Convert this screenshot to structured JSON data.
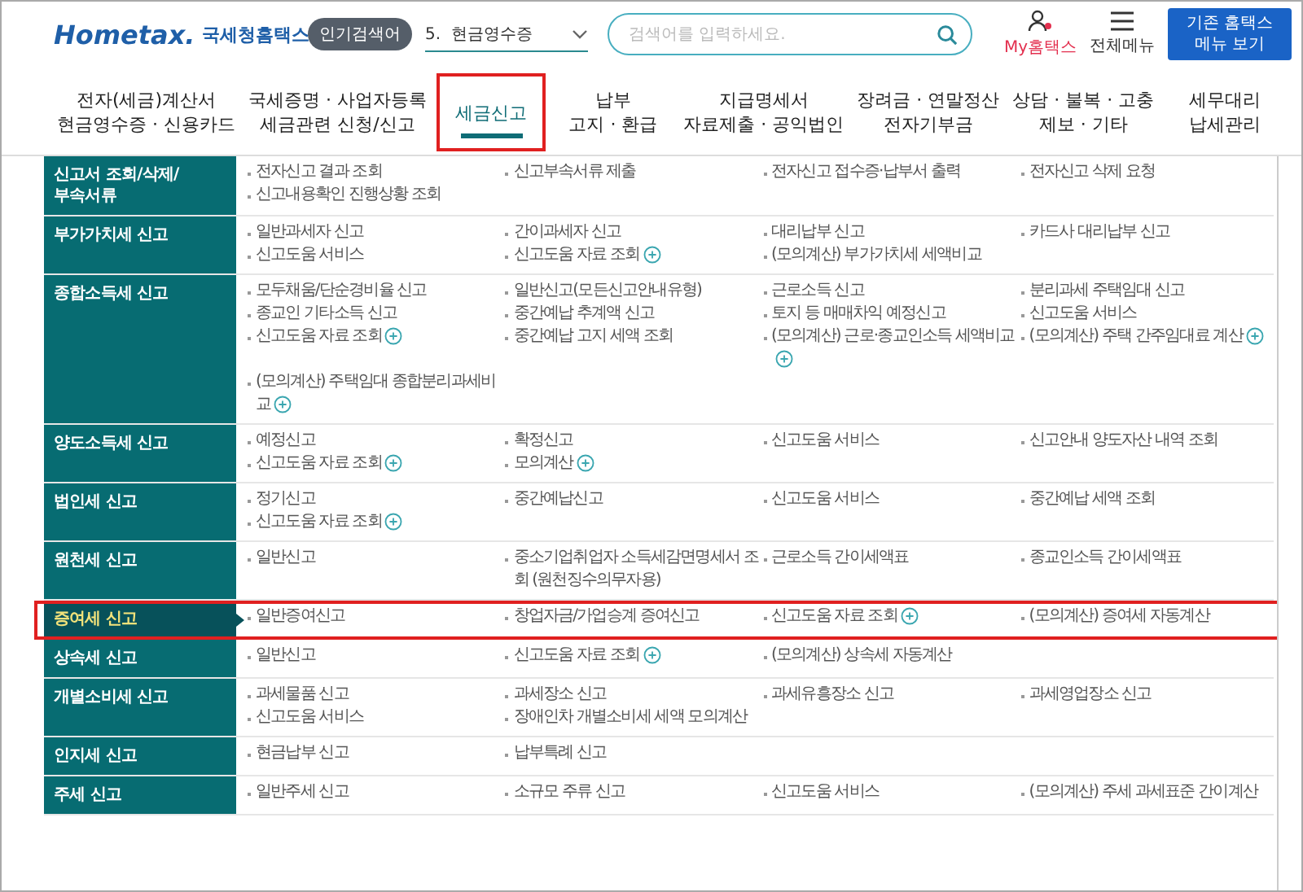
{
  "header": {
    "logo": {
      "brand": "Hometax.",
      "name": "국세청홈택스"
    },
    "popular_badge": "인기검색어",
    "popular_select": "5.  현금영수증",
    "search": {
      "placeholder": "검색어를 입력하세요."
    },
    "my_link": "My홈택스",
    "all_menu": "전체메뉴",
    "legacy_button": [
      "기존 홈택스",
      "메뉴 보기"
    ]
  },
  "nav": [
    {
      "lines": [
        "전자(세금)계산서",
        "현금영수증 · 신용카드"
      ],
      "selected": false,
      "highlighted": false
    },
    {
      "lines": [
        "국세증명 · 사업자등록",
        "세금관련 신청/신고"
      ],
      "selected": false,
      "highlighted": false
    },
    {
      "lines": [
        "세금신고"
      ],
      "selected": true,
      "highlighted": true
    },
    {
      "lines": [
        "납부",
        "고지 · 환급"
      ],
      "selected": false,
      "highlighted": false
    },
    {
      "lines": [
        "지급명세서",
        "자료제출 · 공익법인"
      ],
      "selected": false,
      "highlighted": false
    },
    {
      "lines": [
        "장려금 · 연말정산",
        "전자기부금"
      ],
      "selected": false,
      "highlighted": false
    },
    {
      "lines": [
        "상담 · 불복 · 고충",
        "제보 · 기타"
      ],
      "selected": false,
      "highlighted": false
    },
    {
      "lines": [
        "세무대리",
        "납세관리"
      ],
      "selected": false,
      "highlighted": false
    }
  ],
  "sections": [
    {
      "title": "신고서 조회/삭제/\n부속서류",
      "selected": false,
      "highlighted": false,
      "items": [
        {
          "label": "전자신고 결과 조회",
          "plus": false
        },
        {
          "label": "신고부속서류 제출",
          "plus": false
        },
        {
          "label": "전자신고 접수증·납부서 출력",
          "plus": false
        },
        {
          "label": "전자신고 삭제 요청",
          "plus": false
        },
        {
          "label": "신고내용확인 진행상황 조회",
          "plus": false
        }
      ]
    },
    {
      "title": "부가가치세 신고",
      "selected": false,
      "highlighted": false,
      "items": [
        {
          "label": "일반과세자 신고",
          "plus": false
        },
        {
          "label": "간이과세자 신고",
          "plus": false
        },
        {
          "label": "대리납부 신고",
          "plus": false
        },
        {
          "label": "카드사 대리납부 신고",
          "plus": false
        },
        {
          "label": "신고도움 서비스",
          "plus": false
        },
        {
          "label": "신고도움 자료 조회",
          "plus": true
        },
        {
          "label": "(모의계산) 부가가치세 세액비교",
          "plus": false
        }
      ]
    },
    {
      "title": "종합소득세 신고",
      "selected": false,
      "highlighted": false,
      "items": [
        {
          "label": "모두채움/단순경비율 신고",
          "plus": false
        },
        {
          "label": "일반신고(모든신고안내유형)",
          "plus": false
        },
        {
          "label": "근로소득 신고",
          "plus": false
        },
        {
          "label": "분리과세 주택임대 신고",
          "plus": false
        },
        {
          "label": "종교인 기타소득 신고",
          "plus": false
        },
        {
          "label": "중간예납 추계액 신고",
          "plus": false
        },
        {
          "label": "토지 등 매매차익 예정신고",
          "plus": false
        },
        {
          "label": "신고도움 서비스",
          "plus": false
        },
        {
          "label": "신고도움 자료 조회",
          "plus": true
        },
        {
          "label": "중간예납 고지 세액 조회",
          "plus": false
        },
        {
          "label": "(모의계산) 근로·종교인소득 세액비교",
          "plus": true
        },
        {
          "label": "(모의계산) 주택 간주임대료 계산",
          "plus": true
        },
        {
          "label": "(모의계산) 주택임대 종합분리과세비교",
          "plus": true
        }
      ]
    },
    {
      "title": "양도소득세 신고",
      "selected": false,
      "highlighted": false,
      "items": [
        {
          "label": "예정신고",
          "plus": false
        },
        {
          "label": "확정신고",
          "plus": false
        },
        {
          "label": "신고도움 서비스",
          "plus": false
        },
        {
          "label": "신고안내 양도자산 내역 조회",
          "plus": false
        },
        {
          "label": "신고도움 자료 조회",
          "plus": true
        },
        {
          "label": "모의계산",
          "plus": true
        }
      ]
    },
    {
      "title": "법인세 신고",
      "selected": false,
      "highlighted": false,
      "items": [
        {
          "label": "정기신고",
          "plus": false
        },
        {
          "label": "중간예납신고",
          "plus": false
        },
        {
          "label": "신고도움 서비스",
          "plus": false
        },
        {
          "label": "중간예납 세액 조회",
          "plus": false
        },
        {
          "label": "신고도움 자료 조회",
          "plus": true
        }
      ]
    },
    {
      "title": "원천세 신고",
      "selected": false,
      "highlighted": false,
      "items": [
        {
          "label": "일반신고",
          "plus": false
        },
        {
          "label": "중소기업취업자 소득세감면명세서 조회 (원천징수의무자용)",
          "plus": false
        },
        {
          "label": "근로소득 간이세액표",
          "plus": false
        },
        {
          "label": "종교인소득 간이세액표",
          "plus": false
        }
      ]
    },
    {
      "title": "증여세 신고",
      "selected": true,
      "highlighted": true,
      "items": [
        {
          "label": "일반증여신고",
          "plus": false
        },
        {
          "label": "창업자금/가업승계 증여신고",
          "plus": false
        },
        {
          "label": "신고도움 자료 조회",
          "plus": true
        },
        {
          "label": "(모의계산) 증여세 자동계산",
          "plus": false
        }
      ]
    },
    {
      "title": "상속세 신고",
      "selected": false,
      "highlighted": false,
      "items": [
        {
          "label": "일반신고",
          "plus": false
        },
        {
          "label": "신고도움 자료 조회",
          "plus": true
        },
        {
          "label": "(모의계산) 상속세 자동계산",
          "plus": false
        }
      ]
    },
    {
      "title": "개별소비세 신고",
      "selected": false,
      "highlighted": false,
      "items": [
        {
          "label": "과세물품 신고",
          "plus": false
        },
        {
          "label": "과세장소 신고",
          "plus": false
        },
        {
          "label": "과세유흥장소 신고",
          "plus": false
        },
        {
          "label": "과세영업장소 신고",
          "plus": false
        },
        {
          "label": "신고도움 서비스",
          "plus": false
        },
        {
          "label": "장애인차 개별소비세 세액 모의계산",
          "plus": false
        }
      ]
    },
    {
      "title": "인지세 신고",
      "selected": false,
      "highlighted": false,
      "items": [
        {
          "label": "현금납부 신고",
          "plus": false
        },
        {
          "label": "납부특례 신고",
          "plus": false
        }
      ]
    },
    {
      "title": "주세 신고",
      "selected": false,
      "highlighted": false,
      "items": [
        {
          "label": "일반주세 신고",
          "plus": false
        },
        {
          "label": "소규모 주류 신고",
          "plus": false
        },
        {
          "label": "신고도움 서비스",
          "plus": false
        },
        {
          "label": "(모의계산) 주세 과세표준 간이계산",
          "plus": false
        }
      ]
    }
  ]
}
